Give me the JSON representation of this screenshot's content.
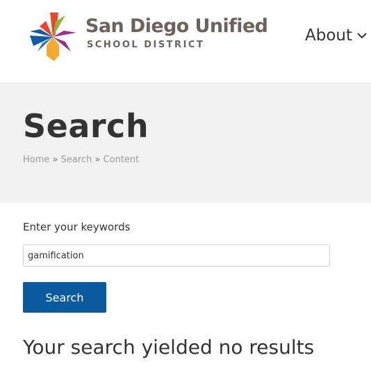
{
  "header": {
    "brand_name": "San Diego Unified",
    "brand_subtitle": "SCHOOL DISTRICT",
    "logo_icon": "star-logo-icon",
    "nav_about_label": "About",
    "nav_about_icon": "chevron-down-icon",
    "logo_colors": [
      "#e9462b",
      "#8cb63c",
      "#9b2f8f",
      "#f7a932",
      "#0e5aa7"
    ]
  },
  "banner": {
    "title": "Search",
    "breadcrumb": {
      "home": "Home",
      "separator": "»",
      "search": "Search",
      "content": "Content"
    }
  },
  "search_form": {
    "label": "Enter your keywords",
    "value": "gamification",
    "button_label": "Search"
  },
  "results": {
    "message": "Your search yielded no results"
  },
  "colors": {
    "brand_text": "#6d625c",
    "banner_bg": "#f2f2f2",
    "button_bg": "#0a5aa0",
    "breadcrumb": "#9a9a9a",
    "text": "#333333"
  }
}
